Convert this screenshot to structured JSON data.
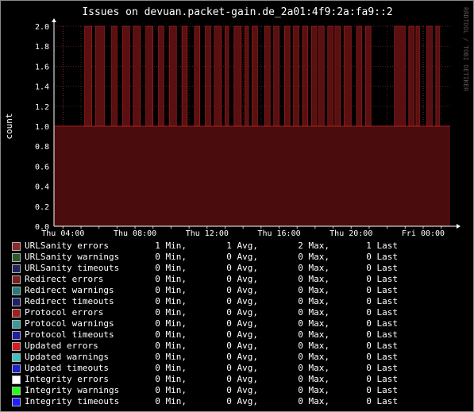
{
  "chart_data": {
    "type": "area",
    "title": "Issues on devuan.packet-gain.de_2a01:4f9:2a:fa9::2",
    "ylabel": "count",
    "watermark": "RRDTOOL / TOBI OETIKER",
    "ylim": [
      0,
      2.0
    ],
    "yticks": [
      "2.0",
      "1.8",
      "1.6",
      "1.4",
      "1.2",
      "1.0",
      "0.8",
      "0.6",
      "0.4",
      "0.2",
      "0.0"
    ],
    "xticks": [
      "Thu 04:00",
      "Thu 08:00",
      "Thu 12:00",
      "Thu 16:00",
      "Thu 20:00",
      "Fri 00:00"
    ],
    "grid": true,
    "colors": {
      "background": "#000000",
      "fill": "#4a0c0c",
      "line": "#b02222",
      "grid": "#7a2a2a"
    },
    "series": [
      {
        "name": "URLSanity errors",
        "x_hours": [
          3.5,
          25.5
        ],
        "spikes": [
          [
            5.2,
            5.6
          ],
          [
            5.8,
            6.3
          ],
          [
            6.7,
            7.0
          ],
          [
            7.3,
            7.7
          ],
          [
            7.9,
            8.3
          ],
          [
            8.6,
            9.0
          ],
          [
            9.3,
            9.6
          ],
          [
            9.9,
            10.3
          ],
          [
            10.6,
            10.9
          ],
          [
            11.3,
            11.6
          ],
          [
            11.9,
            12.2
          ],
          [
            12.4,
            12.8
          ],
          [
            13.0,
            13.2
          ],
          [
            13.5,
            13.9
          ],
          [
            14.1,
            14.3
          ],
          [
            14.5,
            14.8
          ],
          [
            15.2,
            15.5
          ],
          [
            15.7,
            16.0
          ],
          [
            16.3,
            16.6
          ],
          [
            16.8,
            17.1
          ],
          [
            17.3,
            17.6
          ],
          [
            17.8,
            18.1
          ],
          [
            18.2,
            18.5
          ],
          [
            18.7,
            19.0
          ],
          [
            19.1,
            19.4
          ],
          [
            19.6,
            20.0
          ],
          [
            20.3,
            20.6
          ],
          [
            20.8,
            21.1
          ],
          [
            22.4,
            23.0
          ],
          [
            23.2,
            23.5
          ],
          [
            23.6,
            23.8
          ],
          [
            24.2,
            24.5
          ],
          [
            24.7,
            24.9
          ]
        ],
        "base": 1,
        "peak": 2
      }
    ]
  },
  "legend": {
    "items": [
      {
        "label": "URLSanity errors",
        "color": "#8a2a2a",
        "min": "1 Min,",
        "avg": "1 Avg,",
        "max": "2 Max,",
        "last": "1 Last"
      },
      {
        "label": "URLSanity warnings",
        "color": "#2a5a2a",
        "min": "0 Min,",
        "avg": "0 Avg,",
        "max": "0 Max,",
        "last": "0 Last"
      },
      {
        "label": "URLSanity timeouts",
        "color": "#24245a",
        "min": "0 Min,",
        "avg": "0 Avg,",
        "max": "0 Max,",
        "last": "0 Last"
      },
      {
        "label": "Redirect errors",
        "color": "#7a2020",
        "min": "0 Min,",
        "avg": "0 Avg,",
        "max": "0 Max,",
        "last": "0 Last"
      },
      {
        "label": "Redirect warnings",
        "color": "#2a7a7a",
        "min": "0 Min,",
        "avg": "0 Avg,",
        "max": "0 Max,",
        "last": "0 Last"
      },
      {
        "label": "Redirect timeouts",
        "color": "#20206a",
        "min": "0 Min,",
        "avg": "0 Avg,",
        "max": "0 Max,",
        "last": "0 Last"
      },
      {
        "label": "Protocol errors",
        "color": "#a02020",
        "min": "0 Min,",
        "avg": "0 Avg,",
        "max": "0 Max,",
        "last": "0 Last"
      },
      {
        "label": "Protocol warnings",
        "color": "#3a9a9a",
        "min": "0 Min,",
        "avg": "0 Avg,",
        "max": "0 Max,",
        "last": "0 Last"
      },
      {
        "label": "Protocol timeouts",
        "color": "#2020a0",
        "min": "0 Min,",
        "avg": "0 Avg,",
        "max": "0 Max,",
        "last": "0 Last"
      },
      {
        "label": "Updated errors",
        "color": "#d02020",
        "min": "0 Min,",
        "avg": "0 Avg,",
        "max": "0 Max,",
        "last": "0 Last"
      },
      {
        "label": "Updated warnings",
        "color": "#40c0c0",
        "min": "0 Min,",
        "avg": "0 Avg,",
        "max": "0 Max,",
        "last": "0 Last"
      },
      {
        "label": "Updated timeouts",
        "color": "#2020d0",
        "min": "0 Min,",
        "avg": "0 Avg,",
        "max": "0 Max,",
        "last": "0 Last"
      },
      {
        "label": "Integrity errors",
        "color": "#ffffff",
        "min": "0 Min,",
        "avg": "0 Avg,",
        "max": "0 Max,",
        "last": "0 Last"
      },
      {
        "label": "Integrity warnings",
        "color": "#20ff20",
        "min": "0 Min,",
        "avg": "0 Avg,",
        "max": "0 Max,",
        "last": "0 Last"
      },
      {
        "label": "Integrity timeouts",
        "color": "#2020ff",
        "min": "0 Min,",
        "avg": "0 Avg,",
        "max": "0 Max,",
        "last": "0 Last"
      }
    ]
  }
}
